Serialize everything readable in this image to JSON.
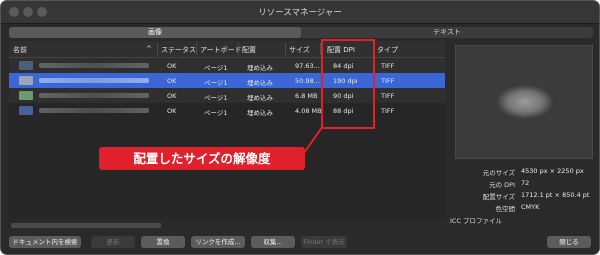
{
  "window": {
    "title": "リソースマネージャー"
  },
  "tabs": [
    {
      "label": "画像",
      "active": true
    },
    {
      "label": "テキスト",
      "active": false
    }
  ],
  "table": {
    "headers": {
      "name": "名前",
      "sort_indicator": "^",
      "status": "ステータス",
      "artboard": "アートボード",
      "placement": "配置",
      "size": "サイズ",
      "dpi": "配置 DPI",
      "type": "タイプ"
    },
    "rows": [
      {
        "status": "OK",
        "artboard": "ページ1",
        "placement": "埋め込み",
        "size": "97.63...",
        "dpi": "84 dpi",
        "type": "TIFF",
        "thumb_color": "#4a5f7c"
      },
      {
        "status": "OK",
        "artboard": "ページ1",
        "placement": "埋め込み",
        "size": "50.98...",
        "dpi": "190 dpi",
        "type": "TIFF",
        "thumb_color": "#9aa6b8",
        "selected": true
      },
      {
        "status": "OK",
        "artboard": "ページ1",
        "placement": "埋め込み",
        "size": "6.8 MB",
        "dpi": "90 dpi",
        "type": "TIFF",
        "thumb_color": "#6c9a72"
      },
      {
        "status": "OK",
        "artboard": "ページ1",
        "placement": "埋め込み",
        "size": "4.08 MB",
        "dpi": "88 dpi",
        "type": "TIFF",
        "thumb_color": "#4a5f9c"
      }
    ]
  },
  "annotation": {
    "text": "配置したサイズの解像度",
    "color": "#e0202b"
  },
  "info": [
    {
      "label": "元のサイズ",
      "value": "4530 px × 2250 px"
    },
    {
      "label": "元の DPI",
      "value": "72"
    },
    {
      "label": "配置サイズ",
      "value": "1712.1 pt × 850.4 pt"
    },
    {
      "label": "色空間",
      "value": "CMYK"
    },
    {
      "label": "ICC プロファイル",
      "value": ""
    }
  ],
  "buttons": {
    "inspect_doc": "ドキュメント内を検索",
    "update": "更新",
    "replace": "置換",
    "create_link": "リンクを作成...",
    "collect": "収集...",
    "show_in_finder": "Finder で表示",
    "close": "閉じる"
  },
  "colors": {
    "selection": "#3a66d6",
    "window_bg": "#2a2a2a"
  }
}
